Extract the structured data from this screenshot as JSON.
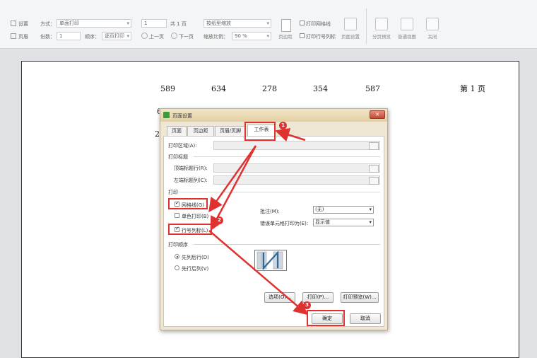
{
  "toolbar": {
    "row1": {
      "setting": "设置",
      "mode_label": "方式：",
      "mode_value": "单面打印",
      "page_value": "1",
      "page_total": "共 1 页",
      "scale_value": "按纸型缩放",
      "show_grid": "打印网格线"
    },
    "row2": {
      "header": "页眉",
      "copies_label": "份数：",
      "copies_value": "1",
      "order_label": "顺序：",
      "order_value": "逐页打印",
      "prev_page": "上一页",
      "next_page": "下一页",
      "zoom_label": "缩放比例：",
      "zoom_value": "90 %",
      "show_rowcol": "打印行号列标"
    },
    "buttons": [
      "页边距",
      "页面设置",
      "分页预览",
      "普通视图",
      "关闭"
    ]
  },
  "page": {
    "numbers": [
      "589",
      "634",
      "278",
      "354",
      "587"
    ],
    "partial_left1": "6",
    "partial_left2": "2",
    "page_label": "第 1 页"
  },
  "dialog": {
    "title": "页面设置",
    "tabs": [
      "页面",
      "页边距",
      "页眉/页脚",
      "工作表"
    ],
    "active_tab": "工作表",
    "print_area_label": "打印区域(A):",
    "print_titles_group": "打印标题",
    "top_rows_label": "顶端标题行(R):",
    "left_cols_label": "左端标题列(C):",
    "print_group": "打印",
    "gridlines_label": "网格线(G)",
    "mono_label": "单色打印(B)",
    "rowcol_label": "行号列标(L)",
    "comments_label": "批注(M):",
    "comments_value": "(无)",
    "errors_label": "错误单元格打印为(E):",
    "errors_value": "显示值",
    "order_group": "打印顺序",
    "order_down": "先列后行(D)",
    "order_over": "先行后列(V)",
    "options_button": "选项(O)...",
    "print_button": "打印(P)...",
    "preview_button": "打印预览(W)...",
    "ok_button": "确定",
    "cancel_button": "取消"
  },
  "annotations": {
    "badge1": "1",
    "badge2": "2",
    "badge3": "3",
    "color": "#e03131"
  }
}
